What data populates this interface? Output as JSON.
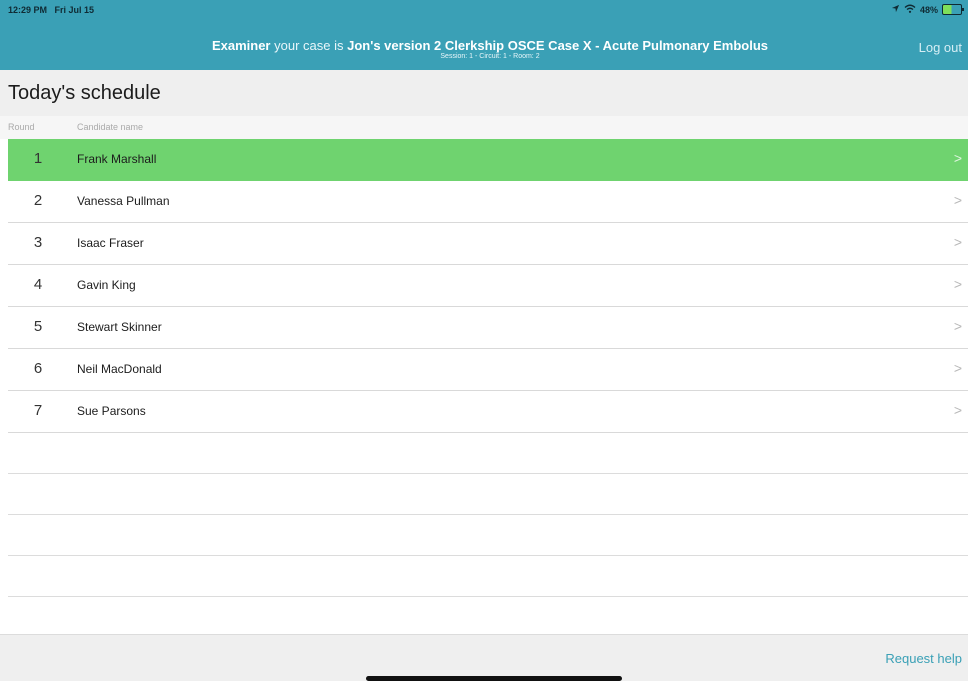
{
  "status_bar": {
    "time": "12:29 PM",
    "date": "Fri Jul 15",
    "battery": "48%"
  },
  "header": {
    "role": "Examiner",
    "intro": "your case is",
    "case_title": "Jon's version 2 Clerkship OSCE Case X - Acute Pulmonary Embolus",
    "session_info": "Session: 1  -  Circuit: 1  -  Room: 2",
    "logout_label": "Log out",
    "color": "#3aa0b6"
  },
  "page": {
    "title": "Today's schedule"
  },
  "columns": {
    "round": "Round",
    "candidate": "Candidate name"
  },
  "rows": [
    {
      "round": "1",
      "name": "Frank Marshall"
    },
    {
      "round": "2",
      "name": "Vanessa Pullman"
    },
    {
      "round": "3",
      "name": "Isaac Fraser"
    },
    {
      "round": "4",
      "name": "Gavin King"
    },
    {
      "round": "5",
      "name": "Stewart Skinner"
    },
    {
      "round": "6",
      "name": "Neil MacDonald"
    },
    {
      "round": "7",
      "name": "Sue Parsons"
    }
  ],
  "active_color": "#6fd36f",
  "icons": {
    "row_chevron": ">",
    "location": "location-arrow-icon",
    "wifi": "wifi-icon",
    "battery": "battery-charging-icon"
  },
  "footer": {
    "request_help_label": "Request help"
  }
}
